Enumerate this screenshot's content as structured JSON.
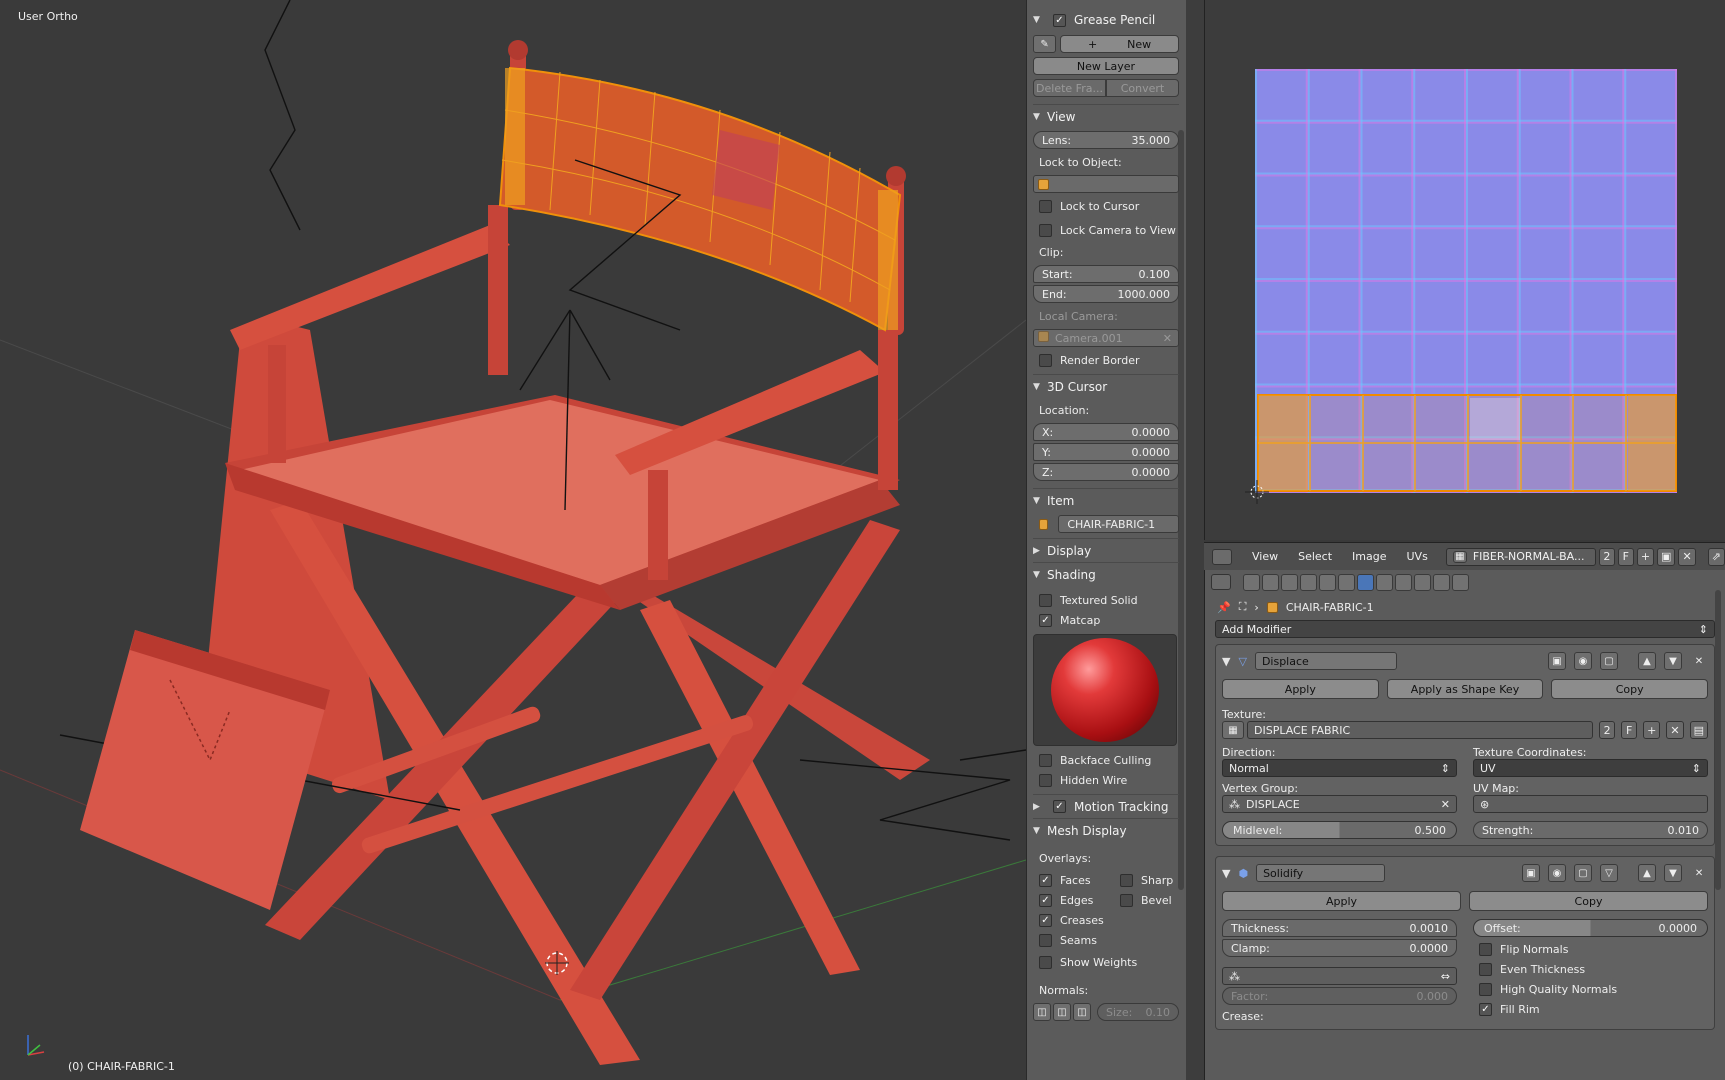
{
  "viewport": {
    "view_name": "User Ortho",
    "object_label": "(0) CHAIR-FABRIC-1"
  },
  "npanel": {
    "grease_pencil": {
      "title": "Grease Pencil",
      "enabled": true,
      "new_label": "New",
      "new_layer_label": "New Layer",
      "delete_frame_label": "Delete Fra...",
      "convert_label": "Convert"
    },
    "view": {
      "title": "View",
      "lens_label": "Lens:",
      "lens_value": "35.000",
      "lock_to_object_label": "Lock to Object:",
      "lock_to_cursor_label": "Lock to Cursor",
      "lock_camera_label": "Lock Camera to View",
      "clip_label": "Clip:",
      "start_label": "Start:",
      "start_value": "0.100",
      "end_label": "End:",
      "end_value": "1000.000",
      "local_camera_label": "Local Camera:",
      "local_camera_value": "Camera.001",
      "render_border_label": "Render Border"
    },
    "cursor": {
      "title": "3D Cursor",
      "location_label": "Location:",
      "x_label": "X:",
      "x_value": "0.0000",
      "y_label": "Y:",
      "y_value": "0.0000",
      "z_label": "Z:",
      "z_value": "0.0000"
    },
    "item": {
      "title": "Item",
      "name": "CHAIR-FABRIC-1"
    },
    "display": {
      "title": "Display"
    },
    "shading": {
      "title": "Shading",
      "textured_solid_label": "Textured Solid",
      "matcap_label": "Matcap",
      "backface_culling_label": "Backface Culling",
      "hidden_wire_label": "Hidden Wire"
    },
    "motion_tracking": {
      "title": "Motion Tracking",
      "enabled": true
    },
    "mesh_display": {
      "title": "Mesh Display",
      "overlays_label": "Overlays:",
      "faces_label": "Faces",
      "sharp_label": "Sharp",
      "edges_label": "Edges",
      "bevel_label": "Bevel",
      "creases_label": "Creases",
      "seams_label": "Seams",
      "show_weights_label": "Show Weights",
      "normals_label": "Normals:",
      "size_label": "Size:",
      "size_value": "0.10"
    }
  },
  "uv_header": {
    "menus": [
      "View",
      "Select",
      "Image",
      "UVs"
    ],
    "image_name": "FIBER-NORMAL-BA...",
    "users": "2",
    "fake_user": "F"
  },
  "properties": {
    "object_name": "CHAIR-FABRIC-1",
    "add_modifier_label": "Add Modifier",
    "displace": {
      "name": "Displace",
      "apply_label": "Apply",
      "apply_shape_label": "Apply as Shape Key",
      "copy_label": "Copy",
      "texture_label": "Texture:",
      "texture_name": "DISPLACE FABRIC",
      "texture_users": "2",
      "texture_fake": "F",
      "direction_label": "Direction:",
      "direction_value": "Normal",
      "tex_coords_label": "Texture Coordinates:",
      "tex_coords_value": "UV",
      "vertex_group_label": "Vertex Group:",
      "vertex_group_value": "DISPLACE",
      "uv_map_label": "UV Map:",
      "midlevel_label": "Midlevel:",
      "midlevel_value": "0.500",
      "midlevel_fraction": 0.5,
      "strength_label": "Strength:",
      "strength_value": "0.010"
    },
    "solidify": {
      "name": "Solidify",
      "apply_label": "Apply",
      "copy_label": "Copy",
      "thickness_label": "Thickness:",
      "thickness_value": "0.0010",
      "offset_label": "Offset:",
      "offset_value": "0.0000",
      "offset_fraction": 0.5,
      "clamp_label": "Clamp:",
      "clamp_value": "0.0000",
      "flip_normals_label": "Flip Normals",
      "even_thickness_label": "Even Thickness",
      "high_quality_label": "High Quality Normals",
      "factor_label": "Factor:",
      "factor_value": "0.000",
      "fill_rim_label": "Fill Rim",
      "crease_label": "Crease:"
    }
  },
  "colors": {
    "chair": "#d9594a",
    "selection": "#f0900a",
    "accent": "#4a76b8"
  }
}
